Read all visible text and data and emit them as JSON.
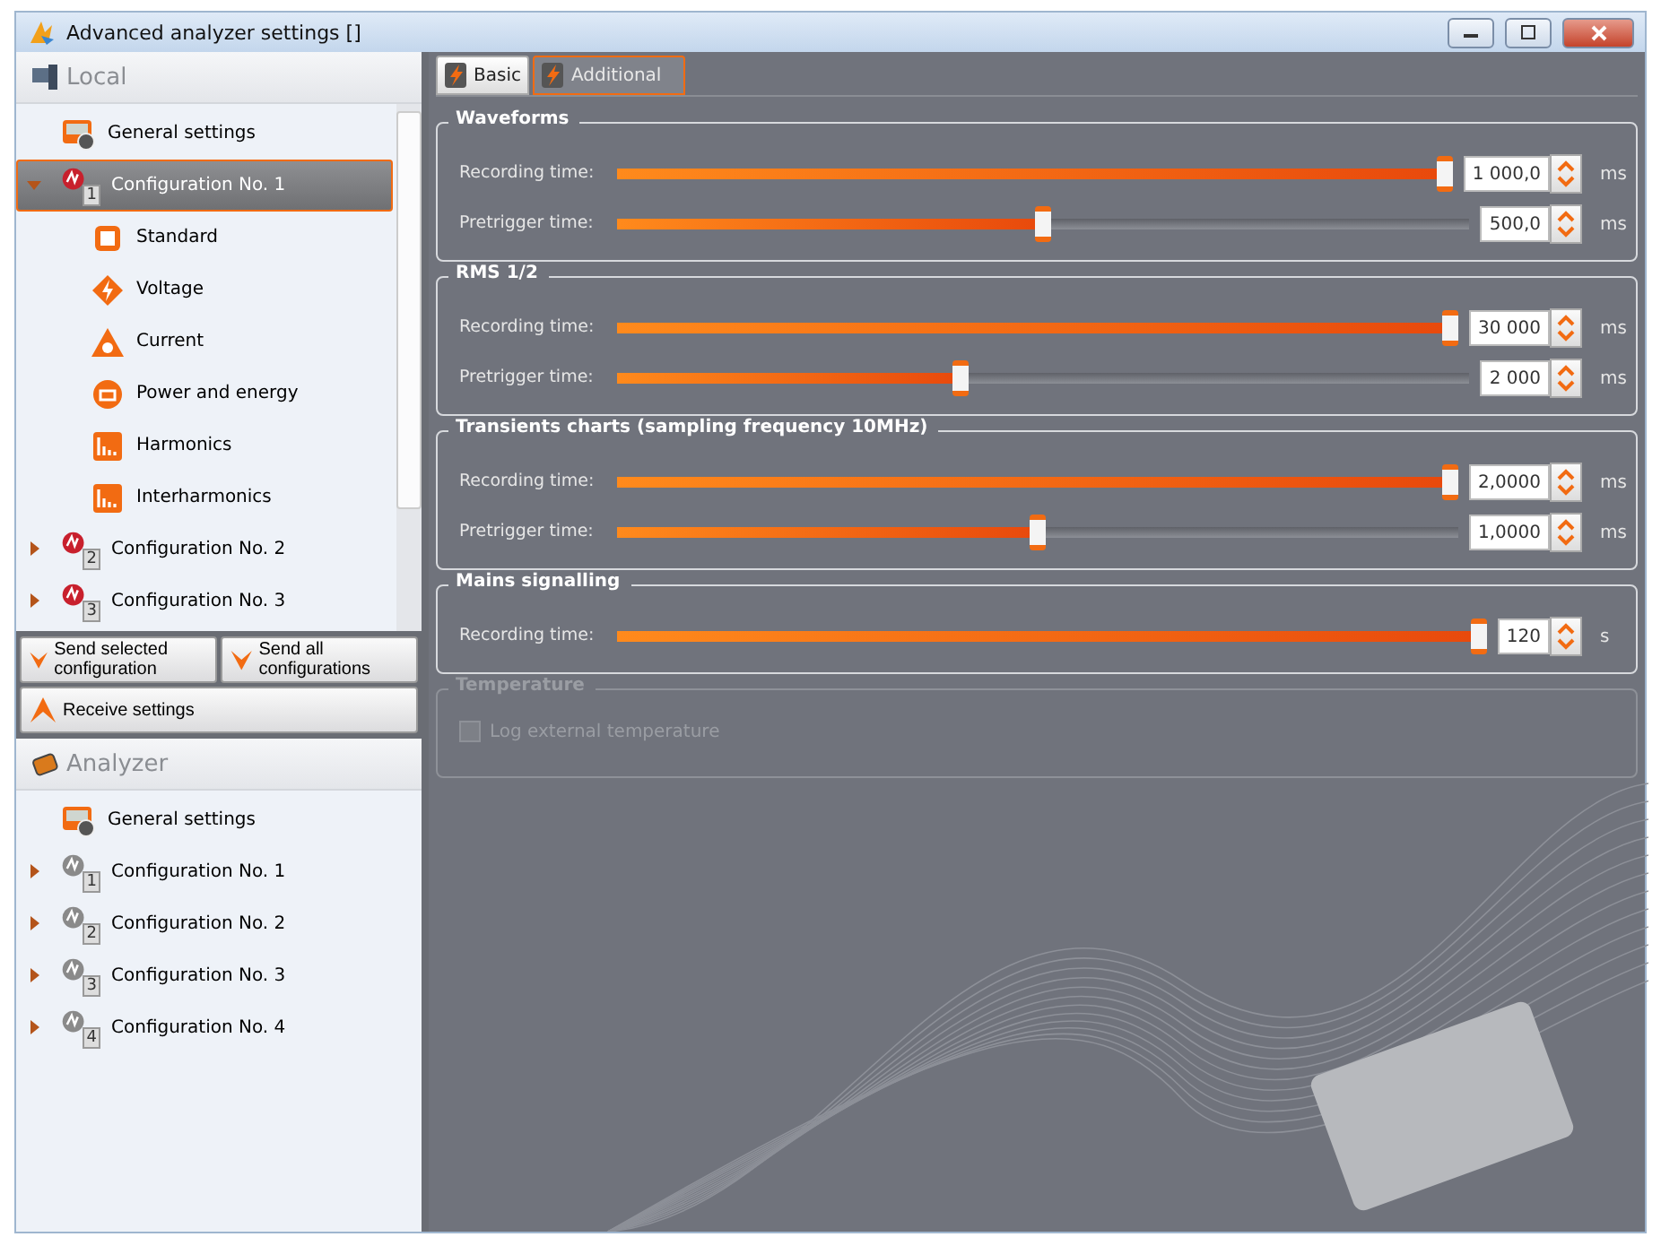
{
  "window": {
    "title": "Advanced analyzer settings []"
  },
  "sections": [
    {
      "kind": "local",
      "title": "Local",
      "items": [
        {
          "kind": "general",
          "label": "General settings",
          "selected": false
        },
        {
          "kind": "config",
          "label": "Configuration No. 1",
          "number": "1",
          "selected": true,
          "expanded": true,
          "children": [
            {
              "kind": "standard",
              "label": "Standard",
              "selected": false
            },
            {
              "kind": "voltage",
              "label": "Voltage",
              "selected": false
            },
            {
              "kind": "current",
              "label": "Current",
              "selected": false
            },
            {
              "kind": "power",
              "label": "Power and energy",
              "selected": false
            },
            {
              "kind": "harmonics",
              "label": "Harmonics",
              "selected": false
            },
            {
              "kind": "interharmonics",
              "label": "Interharmonics",
              "selected": false
            }
          ]
        },
        {
          "kind": "config",
          "label": "Configuration No. 2",
          "number": "2",
          "selected": false,
          "expanded": false
        },
        {
          "kind": "config",
          "label": "Configuration No. 3",
          "number": "3",
          "selected": false,
          "expanded": false
        }
      ],
      "buttons": [
        {
          "kind": "send",
          "label": "Send selected configuration"
        },
        {
          "kind": "send",
          "label": "Send all configurations"
        },
        {
          "kind": "receive",
          "label": "Receive settings"
        }
      ]
    },
    {
      "kind": "analyzer",
      "title": "Analyzer",
      "items": [
        {
          "kind": "general",
          "label": "General settings",
          "selected": false
        },
        {
          "kind": "config",
          "label": "Configuration No. 1",
          "number": "1",
          "selected": false,
          "expanded": false
        },
        {
          "kind": "config",
          "label": "Configuration No. 2",
          "number": "2",
          "selected": false,
          "expanded": false
        },
        {
          "kind": "config",
          "label": "Configuration No. 3",
          "number": "3",
          "selected": false,
          "expanded": false
        },
        {
          "kind": "config",
          "label": "Configuration No. 4",
          "number": "4",
          "selected": false,
          "expanded": false
        }
      ]
    }
  ],
  "tabs": [
    {
      "label": "Basic",
      "selected": false
    },
    {
      "label": "Additional",
      "selected": true
    }
  ],
  "groups": [
    {
      "title": "Waveforms",
      "disabled": false,
      "rows": [
        {
          "kind": "slider",
          "label": "Recording time:",
          "level": 1.0,
          "value": "1 000,0",
          "unit": "ms"
        },
        {
          "kind": "slider",
          "label": "Pretrigger time:",
          "level": 0.5,
          "value": "500,0",
          "unit": "ms"
        }
      ]
    },
    {
      "title": "RMS 1/2",
      "disabled": false,
      "rows": [
        {
          "kind": "slider",
          "label": "Recording time:",
          "level": 1.0,
          "value": "30 000",
          "unit": "ms"
        },
        {
          "kind": "slider",
          "label": "Pretrigger time:",
          "level": 0.4,
          "value": "2 000",
          "unit": "ms"
        }
      ]
    },
    {
      "title": "Transients charts (sampling frequency 10MHz)",
      "disabled": false,
      "rows": [
        {
          "kind": "slider",
          "label": "Recording time:",
          "level": 1.0,
          "value": "2,0000",
          "unit": "ms"
        },
        {
          "kind": "slider",
          "label": "Pretrigger time:",
          "level": 0.5,
          "value": "1,0000",
          "unit": "ms"
        }
      ]
    },
    {
      "title": "Mains signalling",
      "disabled": false,
      "rows": [
        {
          "kind": "slider",
          "label": "Recording time:",
          "level": 1.0,
          "value": "120",
          "unit": "s"
        }
      ]
    },
    {
      "title": "Temperature",
      "disabled": true,
      "rows": [
        {
          "kind": "checkbox",
          "label": "Log external temperature",
          "checked": false
        }
      ]
    }
  ]
}
